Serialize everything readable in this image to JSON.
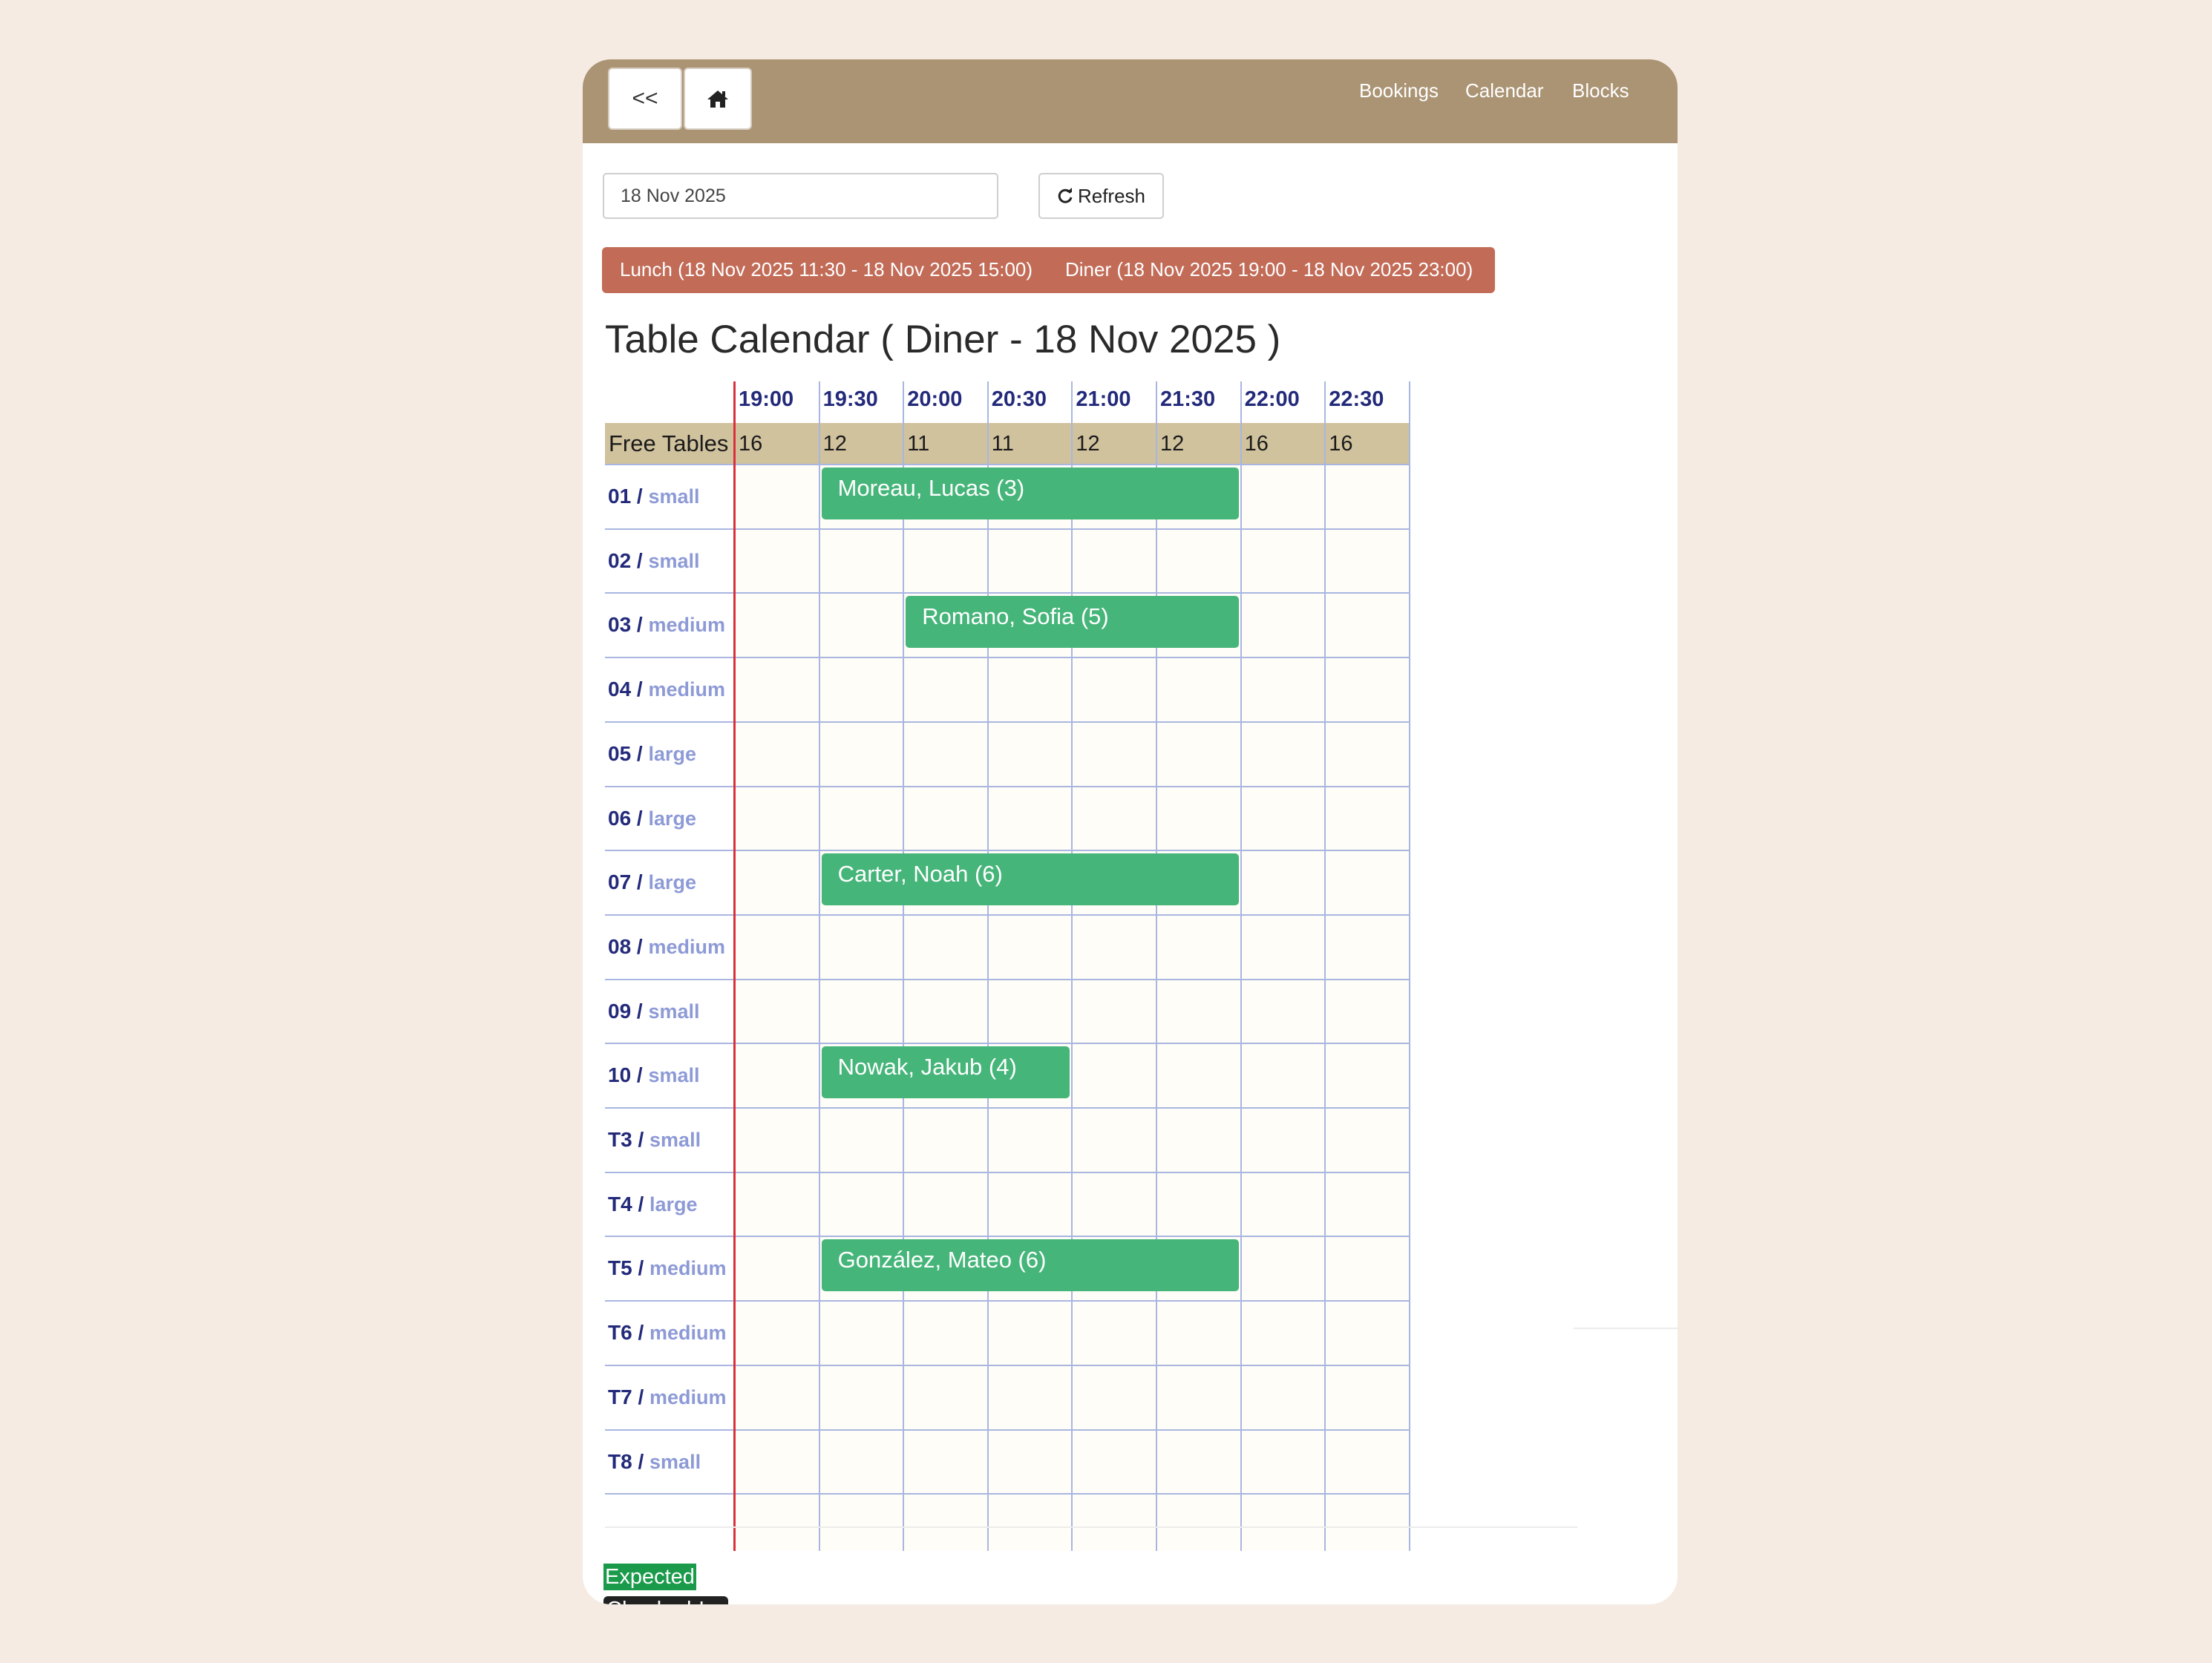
{
  "nav": {
    "back_label": "<<",
    "home_icon": "home-icon",
    "links": [
      "Bookings",
      "Calendar",
      "Blocks"
    ]
  },
  "controls": {
    "date_value": "18 Nov 2025",
    "refresh_icon": "refresh-icon",
    "refresh_label": "Refresh"
  },
  "shifts": {
    "lunch": "Lunch (18 Nov 2025 11:30 - 18 Nov 2025 15:00)",
    "diner": "Diner (18 Nov 2025 19:00 - 18 Nov 2025 23:00)"
  },
  "page_title": "Table Calendar ( Diner - 18 Nov 2025 )",
  "calendar": {
    "times": [
      "19:00",
      "19:30",
      "20:00",
      "20:30",
      "21:00",
      "21:30",
      "22:00",
      "22:30"
    ],
    "free_label": "Free Tables",
    "free_counts": [
      "16",
      "12",
      "11",
      "11",
      "12",
      "12",
      "16",
      "16"
    ],
    "tables": [
      {
        "num": "01",
        "size": "small"
      },
      {
        "num": "02",
        "size": "small"
      },
      {
        "num": "03",
        "size": "medium"
      },
      {
        "num": "04",
        "size": "medium"
      },
      {
        "num": "05",
        "size": "large"
      },
      {
        "num": "06",
        "size": "large"
      },
      {
        "num": "07",
        "size": "large"
      },
      {
        "num": "08",
        "size": "medium"
      },
      {
        "num": "09",
        "size": "small"
      },
      {
        "num": "10",
        "size": "small"
      },
      {
        "num": "T3",
        "size": "small"
      },
      {
        "num": "T4",
        "size": "large"
      },
      {
        "num": "T5",
        "size": "medium"
      },
      {
        "num": "T6",
        "size": "medium"
      },
      {
        "num": "T7",
        "size": "medium"
      },
      {
        "num": "T8",
        "size": "small"
      }
    ],
    "bookings": [
      {
        "label": "Moreau, Lucas (3)",
        "table": "01",
        "start": "19:30",
        "end": "22:00"
      },
      {
        "label": "Romano, Sofia (5)",
        "table": "03",
        "start": "20:00",
        "end": "22:00"
      },
      {
        "label": "Carter, Noah (6)",
        "table": "07",
        "start": "19:30",
        "end": "22:00"
      },
      {
        "label": "Nowak, Jakub (4)",
        "table": "10",
        "start": "19:30",
        "end": "21:00"
      },
      {
        "label": "González, Mateo (6)",
        "table": "T5",
        "start": "19:30",
        "end": "22:00"
      }
    ]
  },
  "legend": {
    "expected": "Expected",
    "checked_in": "Checked-In"
  },
  "colors": {
    "nav_bar": "#ab9474",
    "shift_bar": "#c26c58",
    "free_row": "#d1c29e",
    "booking": "#46b57a",
    "now_line": "#d9303c",
    "grid_line": "#a9b6e0"
  }
}
